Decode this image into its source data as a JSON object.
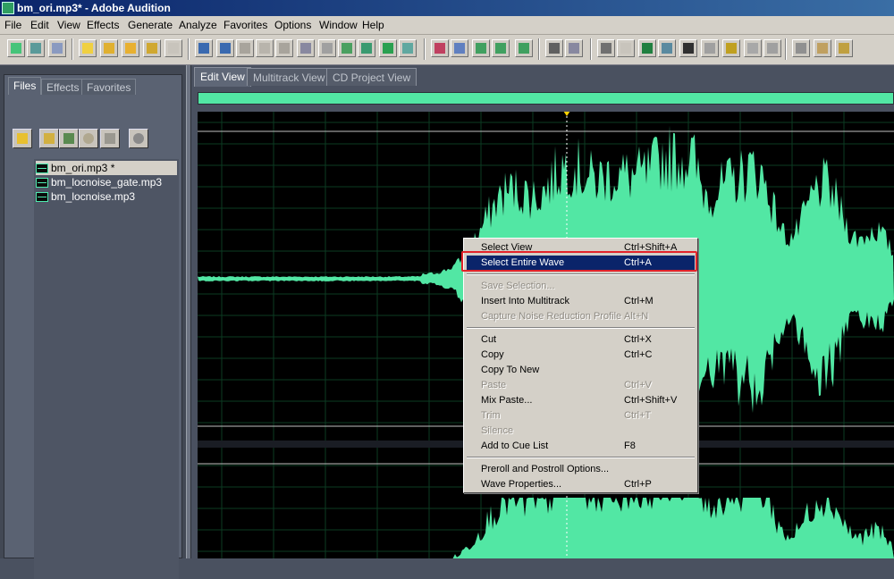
{
  "window": {
    "title": "bm_ori.mp3* - Adobe Audition"
  },
  "menubar": {
    "items": [
      "File",
      "Edit",
      "View",
      "Effects",
      "Generate",
      "Analyze",
      "Favorites",
      "Options",
      "Window",
      "Help"
    ]
  },
  "toolbar": {
    "icons": [
      "waveform-view-icon",
      "multitrack-view-icon",
      "cd-project-icon",
      "new-file-icon",
      "open-file-icon",
      "save-icon",
      "save-all-icon",
      "close-file-icon",
      "undo-icon",
      "redo-icon",
      "repeat-command-icon",
      "copy-icon",
      "paste-icon",
      "cut-icon",
      "trim-icon",
      "mix-paste-icon",
      "insert-cue-icon",
      "spectral-view-icon",
      "frequency-analysis-icon",
      "marquee-icon",
      "hybrid-tool-icon",
      "time-selection-tool-icon",
      "select-tool-icon",
      "snap-icon",
      "zoom-icon",
      "play-icon",
      "time-display-icon",
      "pitch-icon",
      "level-meter-icon",
      "menu-icon",
      "settings-icon",
      "script-icon",
      "help-icon"
    ]
  },
  "left_panel": {
    "tabs": [
      {
        "label": "Files"
      },
      {
        "label": "Effects"
      },
      {
        "label": "Favorites"
      }
    ],
    "buttons": [
      "open-file-icon",
      "import-icon",
      "close-icon",
      "play-icon",
      "insert-icon",
      "options-icon"
    ],
    "files": [
      {
        "name": "bm_ori.mp3 *"
      },
      {
        "name": "bm_locnoise_gate.mp3"
      },
      {
        "name": "bm_locnoise.mp3"
      }
    ]
  },
  "view_tabs": [
    {
      "label": "Edit View"
    },
    {
      "label": "Multitrack View"
    },
    {
      "label": "CD Project View"
    }
  ],
  "colors": {
    "waveform": "#52e7a4",
    "background": "#000000",
    "highlight": "#0a246a",
    "annotation": "#e3232a"
  },
  "context_menu": {
    "items": [
      {
        "label": "Select View",
        "shortcut": "Ctrl+Shift+A",
        "enabled": true
      },
      {
        "label": "Select Entire Wave",
        "shortcut": "Ctrl+A",
        "enabled": true,
        "highlighted": true
      },
      {
        "separator": true
      },
      {
        "label": "Save Selection...",
        "shortcut": "",
        "enabled": false
      },
      {
        "label": "Insert Into Multitrack",
        "shortcut": "Ctrl+M",
        "enabled": true
      },
      {
        "label": "Capture Noise Reduction Profile",
        "shortcut": "Alt+N",
        "enabled": false
      },
      {
        "separator": true
      },
      {
        "label": "Cut",
        "shortcut": "Ctrl+X",
        "enabled": true
      },
      {
        "label": "Copy",
        "shortcut": "Ctrl+C",
        "enabled": true
      },
      {
        "label": "Copy To New",
        "shortcut": "",
        "enabled": true
      },
      {
        "label": "Paste",
        "shortcut": "Ctrl+V",
        "enabled": false
      },
      {
        "label": "Mix Paste...",
        "shortcut": "Ctrl+Shift+V",
        "enabled": true
      },
      {
        "label": "Trim",
        "shortcut": "Ctrl+T",
        "enabled": false
      },
      {
        "label": "Silence",
        "shortcut": "",
        "enabled": false
      },
      {
        "label": "Add to Cue List",
        "shortcut": "F8",
        "enabled": true
      },
      {
        "separator": true
      },
      {
        "label": "Preroll and Postroll Options...",
        "shortcut": "",
        "enabled": true
      },
      {
        "label": "Wave Properties...",
        "shortcut": "Ctrl+P",
        "enabled": true
      }
    ]
  }
}
